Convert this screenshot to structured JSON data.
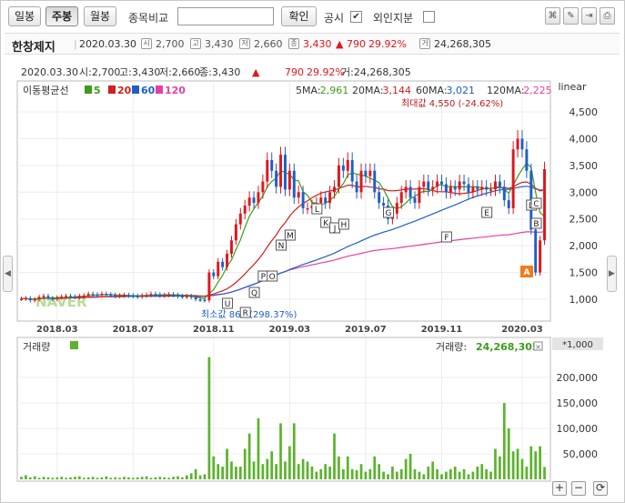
{
  "toolbar": {
    "tab_day": "일봉",
    "tab_week": "주봉",
    "tab_month": "월봉",
    "compare_label": "종목비교",
    "confirm_label": "확인",
    "disclosure_label": "공시",
    "disclosure_checked": "✔",
    "foreign_label": "외인지분",
    "foreign_checked": ""
  },
  "info": {
    "name": "한창제지",
    "date": "2020.03.30",
    "open_icon": "시",
    "open": "2,700",
    "high_icon": "고",
    "high": "3,430",
    "low_icon": "저",
    "low": "2,660",
    "close_icon": "종",
    "close": "3,430",
    "change_sign": "▲",
    "change": "790",
    "change_pct": "29.92%",
    "volume_icon": "거",
    "volume": "24,268,305"
  },
  "chart_data": {
    "type": "candlestick",
    "header": {
      "date": "2020.03.30",
      "open_label": "시:2,700",
      "high_label": "고:3,430",
      "low_label": "저:2,660",
      "close_label": "종:3,430",
      "change_sign": "▲",
      "change": "790",
      "change_pct": "29.92%",
      "volume_label": "거:24,268,305"
    },
    "scale": "linear",
    "ma_title": "이동평균선",
    "ma_legend": [
      {
        "name": "5",
        "color": "#3e9a1e"
      },
      {
        "name": "20",
        "color": "#d21f1f"
      },
      {
        "name": "60",
        "color": "#1f5ec8"
      },
      {
        "name": "120",
        "color": "#e83ea3"
      }
    ],
    "ma_values": [
      {
        "label": "5MA:",
        "value": "2,961",
        "color": "#3e9a1e"
      },
      {
        "label": "20MA:",
        "value": "3,144",
        "color": "#d21f1f"
      },
      {
        "label": "60MA:",
        "value": "3,021",
        "color": "#1f5ec8"
      },
      {
        "label": "120MA:",
        "value": "2,225",
        "color": "#e83ea3"
      }
    ],
    "max_annotation": "최대값 4,550 (-24.62%)",
    "min_annotation": "최소값 861 (298.37%)",
    "watermark": "NAVER",
    "y_ticks": [
      "4,500",
      "4,000",
      "3,500",
      "3,000",
      "2,500",
      "2,000",
      "1,500",
      "1,000"
    ],
    "y_tick_values": [
      4500,
      4000,
      3500,
      3000,
      2500,
      2000,
      1500,
      1000
    ],
    "x_ticks": [
      "2018.03",
      "2018.07",
      "2018.11",
      "2019.03",
      "2019.07",
      "2019.11",
      "2020.03"
    ],
    "x_tick_weeks": [
      8,
      25,
      43,
      60,
      77,
      94,
      112
    ],
    "weekly_close": [
      1010,
      1020,
      980,
      1000,
      1040,
      1060,
      1020,
      1000,
      1030,
      1050,
      1060,
      1050,
      1040,
      1060,
      1070,
      1100,
      1090,
      1080,
      1100,
      1090,
      1080,
      1060,
      1070,
      1080,
      1070,
      1060,
      1050,
      1070,
      1080,
      1100,
      1090,
      1070,
      1080,
      1090,
      1080,
      1060,
      1050,
      1060,
      1040,
      1000,
      990,
      980,
      1500,
      1430,
      1700,
      1600,
      1850,
      2100,
      2400,
      2600,
      2750,
      2900,
      2800,
      3000,
      3200,
      3600,
      3400,
      3100,
      3700,
      3050,
      3400,
      2900,
      3000,
      2700,
      2700,
      2750,
      2800,
      2900,
      2800,
      3000,
      3100,
      3500,
      3400,
      3600,
      3200,
      3000,
      3400,
      3300,
      3400,
      3000,
      2800,
      2750,
      2500,
      2600,
      2800,
      3000,
      3100,
      2900,
      2800,
      3100,
      3200,
      3050,
      3100,
      3200,
      3150,
      3000,
      3100,
      3050,
      3200,
      3150,
      3000,
      3100,
      3050,
      3100,
      3050,
      3050,
      3200,
      3100,
      2850,
      2700,
      3800,
      4000,
      3800,
      3400,
      2300,
      1500,
      2100,
      3430
    ],
    "volume_title": "거래량",
    "volume_label": "거래량:",
    "volume_value": "24,268,305",
    "volume_unit": "*1,000",
    "volume_ticks": [
      "200,000",
      "150,000",
      "100,000",
      "50,000"
    ],
    "volume_tick_values": [
      200000,
      150000,
      100000,
      50000
    ],
    "weekly_volume": [
      5000,
      8000,
      4000,
      6000,
      3000,
      5000,
      4000,
      3000,
      4000,
      5000,
      3000,
      4000,
      5000,
      6000,
      3000,
      4000,
      5000,
      3000,
      4000,
      6000,
      3000,
      4000,
      3000,
      5000,
      4000,
      3000,
      4000,
      5000,
      6000,
      3000,
      4000,
      5000,
      4000,
      3000,
      5000,
      6000,
      4000,
      8000,
      12000,
      20000,
      8000,
      10000,
      240000,
      45000,
      30000,
      25000,
      60000,
      35000,
      25000,
      25000,
      60000,
      90000,
      35000,
      120000,
      30000,
      40000,
      55000,
      30000,
      110000,
      35000,
      65000,
      110000,
      30000,
      40000,
      35000,
      25000,
      15000,
      20000,
      30000,
      25000,
      90000,
      45000,
      20000,
      45000,
      20000,
      18000,
      30000,
      15000,
      20000,
      45000,
      30000,
      15000,
      10000,
      25000,
      15000,
      20000,
      40000,
      50000,
      20000,
      15000,
      10000,
      25000,
      35000,
      20000,
      10000,
      15000,
      20000,
      25000,
      15000,
      20000,
      10000,
      15000,
      25000,
      30000,
      20000,
      15000,
      60000,
      45000,
      150000,
      100000,
      55000,
      60000,
      40000,
      25000,
      65000,
      55000,
      65000,
      24268
    ]
  },
  "controls": {
    "zoom_in": "+",
    "zoom_out": "−",
    "reset": "⟳"
  }
}
